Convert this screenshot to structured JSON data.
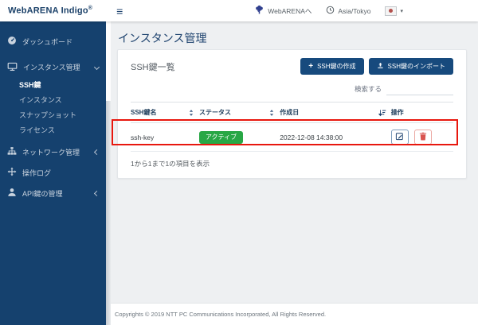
{
  "header": {
    "logo": "WebARENA Indigo",
    "logo_sup": "®",
    "hamburger_glyph": "≡",
    "webarena_link": "WebARENAへ",
    "timezone": "Asia/Tokyo",
    "lang_caret": "▾"
  },
  "sidebar": {
    "items": [
      {
        "label": "ダッシュボード"
      },
      {
        "label": "インスタンス管理"
      },
      {
        "label": "SSH鍵"
      },
      {
        "label": "インスタンス"
      },
      {
        "label": "スナップショット"
      },
      {
        "label": "ライセンス"
      },
      {
        "label": "ネットワーク管理"
      },
      {
        "label": "操作ログ"
      },
      {
        "label": "API鍵の管理"
      }
    ]
  },
  "main": {
    "page_title": "インスタンス管理",
    "panel": {
      "title": "SSH鍵一覧",
      "create_button_plus": "+",
      "create_button_label": "SSH鍵の作成",
      "import_button_label": "SSH鍵のインポート",
      "search_label": "検索する",
      "table": {
        "headers": [
          "SSH鍵名",
          "ステータス",
          "作成日",
          "操作"
        ],
        "rows": [
          {
            "name": "ssh-key",
            "status": "アクティブ",
            "created": "2022-12-08 14:38:00"
          }
        ]
      },
      "summary": "1から1まで1の項目を表示"
    }
  },
  "footer": {
    "copyright": "Copyrights © 2019 NTT PC Communications Incorporated, All Rights Reserved."
  },
  "colors": {
    "sidebar_navy": "#15416e",
    "button_navy": "#174a7d",
    "badge_green": "#28a745",
    "annotation_red": "#e8170e",
    "delete_red": "#d9534f",
    "title_navy": "#1c416d"
  }
}
